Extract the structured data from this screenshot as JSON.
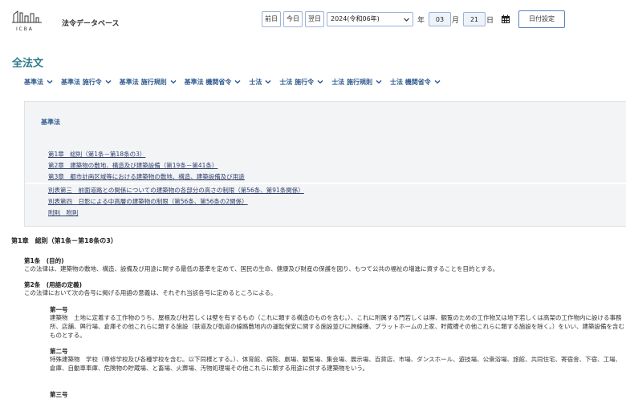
{
  "header": {
    "logo_text": "I C B A",
    "site_title": "法令データベース"
  },
  "datebar": {
    "prev_label": "前日",
    "today_label": "今日",
    "next_label": "翌日",
    "era_value": "2024(令和06年)",
    "year_unit": "年",
    "month_value": "03",
    "month_unit": "月",
    "day_value": "21",
    "day_unit": "日",
    "set_label": "日付設定"
  },
  "page_title": "全法文",
  "tabs": [
    {
      "label": "基準法"
    },
    {
      "label": "基準法 施行令"
    },
    {
      "label": "基準法 施行規則"
    },
    {
      "label": "基準法 機関省令"
    },
    {
      "label": "士法"
    },
    {
      "label": "士法 施行令"
    },
    {
      "label": "士法 施行規則"
    },
    {
      "label": "士法 機関省令"
    }
  ],
  "toc": {
    "heading": "基準法",
    "items": [
      "第1章　総則（第1条－第18条の3）",
      "第2章　建築物の敷地、構造及び建築設備（第19条－第41条）",
      "第3章　都市計画区域等における建築物の敷地、構造、建築設備及び用途"
    ],
    "items2": [
      "別表第三　前面道路との関係についての建築物の各部分の高さの制限（第56条、第91条関係）",
      "別表第四　日影による中高層の建築物の制限（第56条、第56条の2関係）",
      "附則　附則"
    ]
  },
  "content": {
    "chapter": "第1章　総則（第1条－第18条の3）",
    "art1_title": "第1条　(目的)",
    "art1_text": "この法律は、建築物の敷地、構造、設備及び用途に関する最低の基準を定めて、国民の生命、健康及び財産の保護を図り、もつて公共の福祉の増進に資することを目的とする。",
    "art2_title": "第2条　(用語の定義)",
    "art2_text": "この法律において次の各号に掲げる用語の意義は、それぞれ当該各号に定めるところによる。",
    "item1_title": "第一号",
    "item1_text": "建築物　土地に定着する工作物のうち、屋根及び柱若しくは壁を有するもの（これに類する構造のものを含む。）、これに附属する門若しくは塀、観覧のための工作物又は地下若しくは高架の工作物内に設ける事務所、店舗、興行場、倉庫その他これらに類する施設（鉄道及び軌道の線路敷地内の運転保安に関する施設並びに跨線橋、プラットホームの上家、貯蔵槽その他これらに類する施設を除く。）をいい、建築設備を含むものとする。",
    "item2_title": "第二号",
    "item2_text": "特殊建築物　学校（専修学校及び各種学校を含む。以下同様とする。）、体育館、病院、劇場、観覧場、集会場、展示場、百貨店、市場、ダンスホール、遊技場、公衆浴場、旅館、共同住宅、寄宿舎、下宿、工場、倉庫、自動車車庫、危険物の貯蔵場、と畜場、火葬場、汚物処理場その他これらに類する用途に供する建築物をいう。",
    "item3_title": "第三号"
  }
}
